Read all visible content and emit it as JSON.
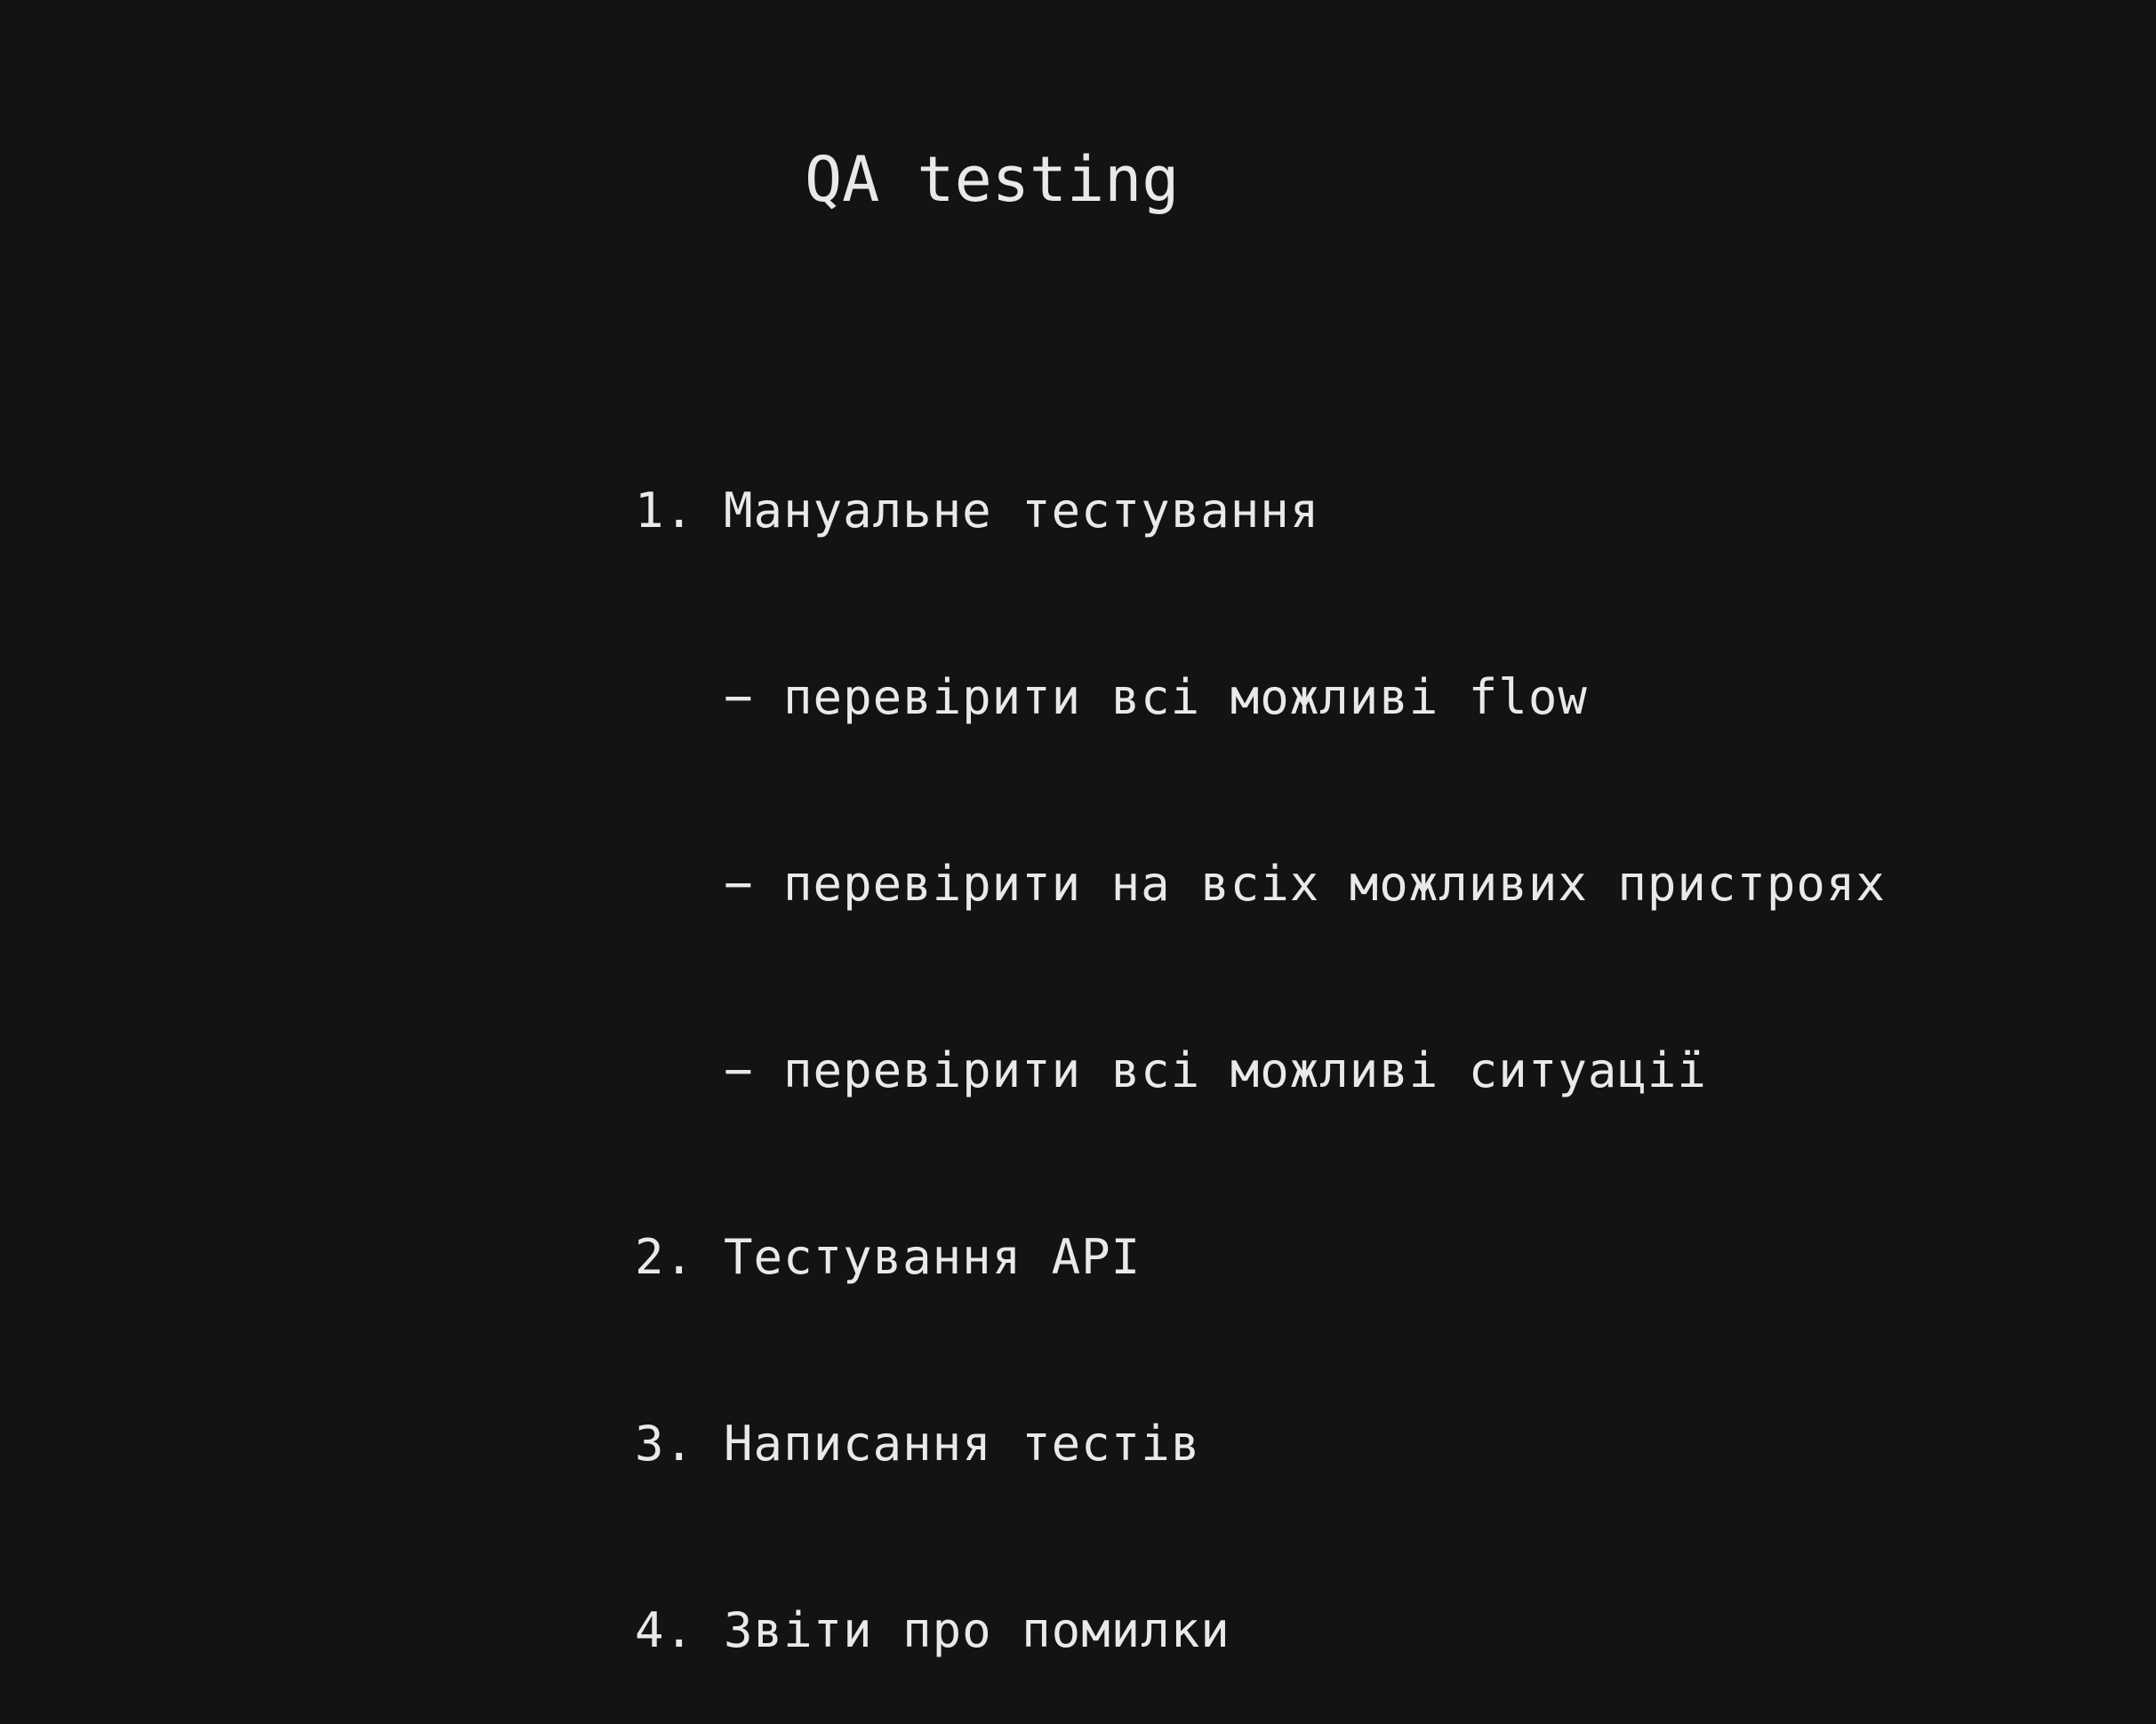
{
  "title": "QA testing",
  "items": [
    {
      "number": "1.",
      "text": "Мануальне тестування",
      "subitems": [
        {
          "marker": "−",
          "text": "перевірити всі можливі flow"
        },
        {
          "marker": "−",
          "text": "перевірити на всіх можливих пристроях"
        },
        {
          "marker": "−",
          "text": "перевірити всі можливі ситуації"
        }
      ]
    },
    {
      "number": "2.",
      "text": "Тестування API"
    },
    {
      "number": "3.",
      "text": "Написання тестів"
    },
    {
      "number": "4.",
      "text": "Звіти про помилки"
    }
  ]
}
